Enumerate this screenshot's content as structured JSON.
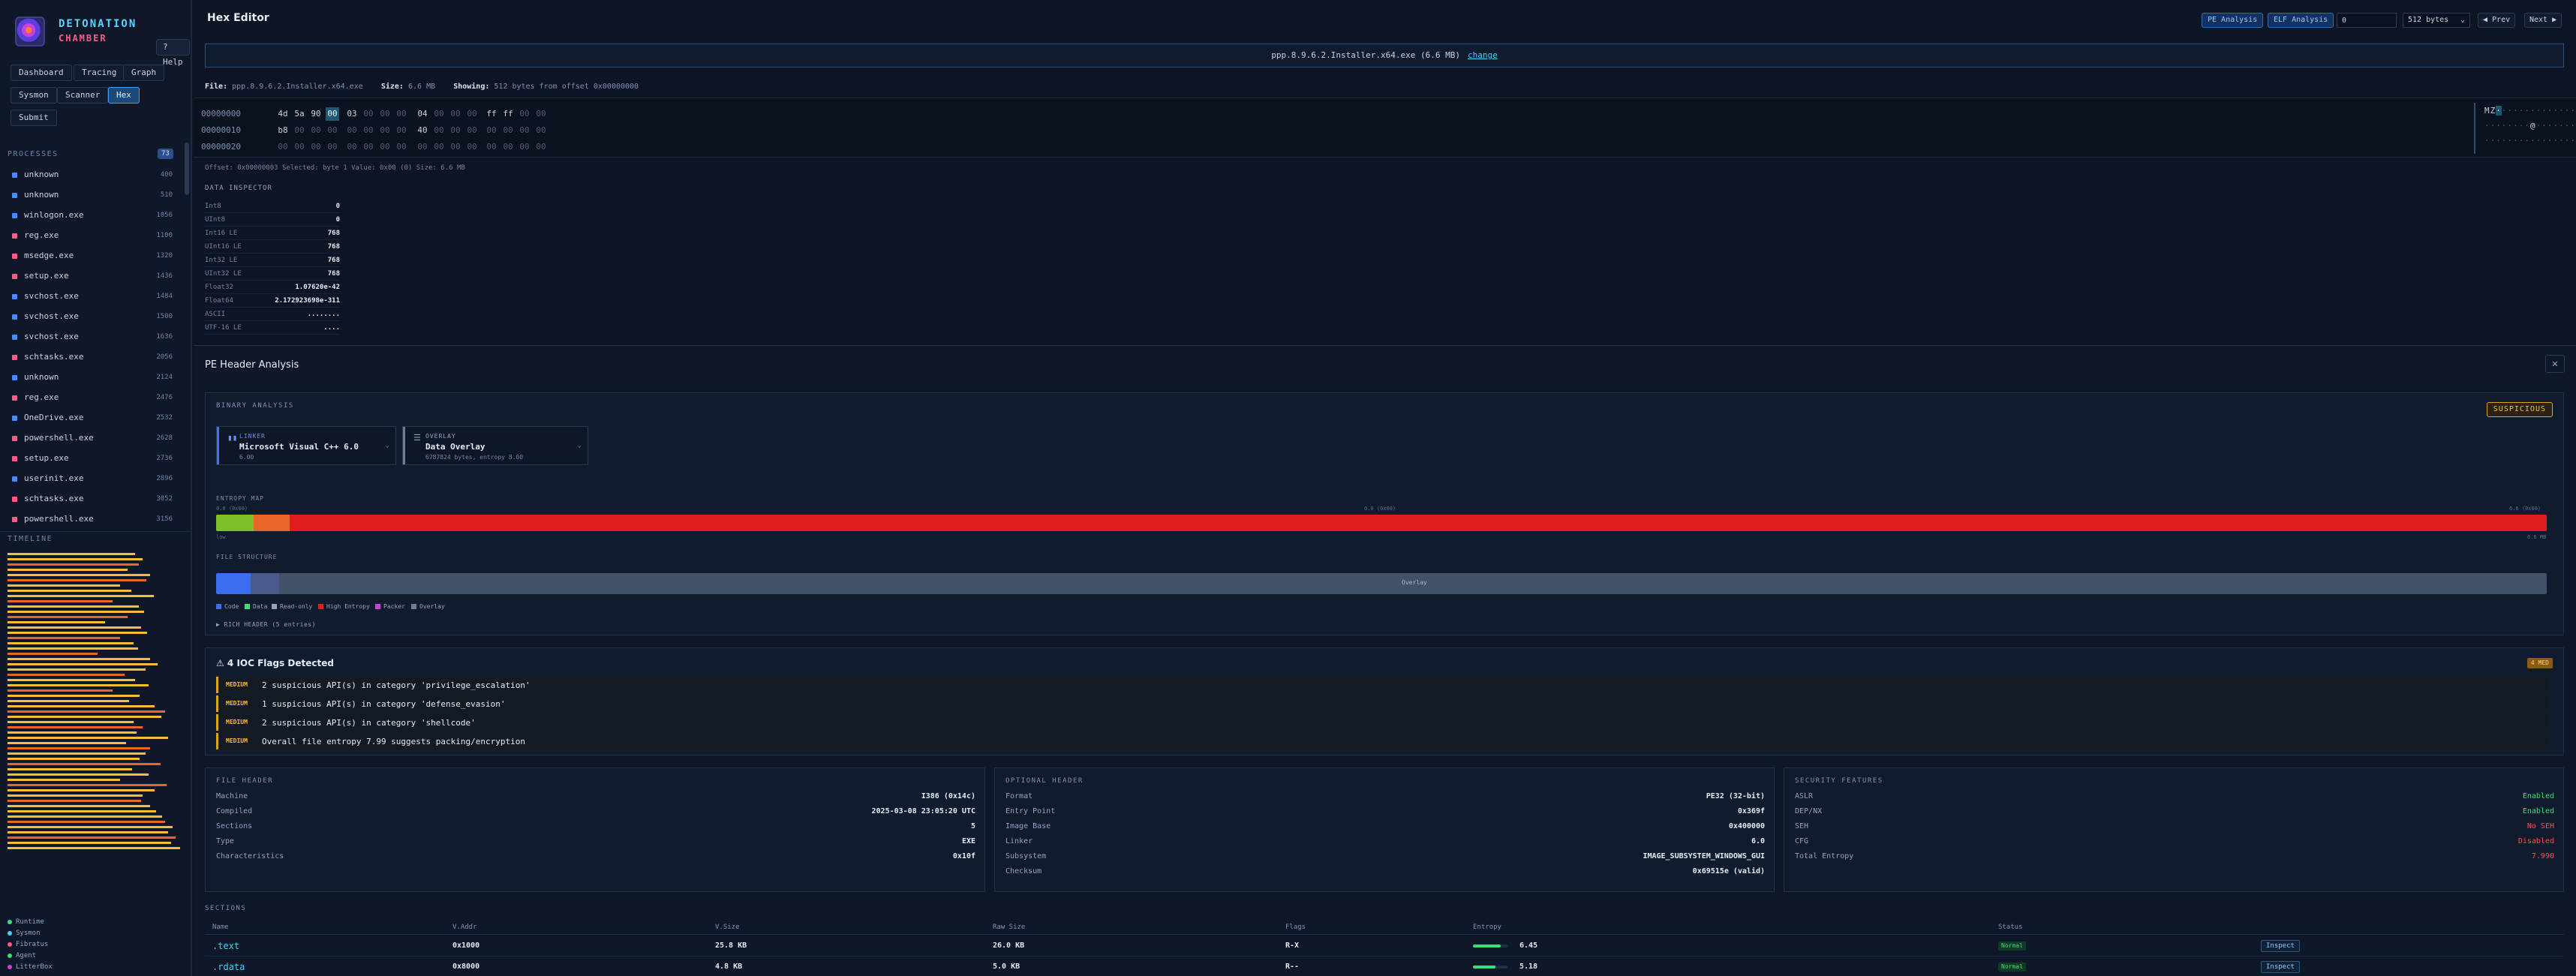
{
  "brand": {
    "title": "DETONATION",
    "subtitle": "CHAMBER",
    "help": "? Help"
  },
  "nav": [
    {
      "label": "Dashboard",
      "active": false
    },
    {
      "label": "Tracing",
      "active": false
    },
    {
      "label": "Graph",
      "active": false
    },
    {
      "label": "Sysmon",
      "active": false
    },
    {
      "label": "Scanner",
      "active": false
    },
    {
      "label": "Hex",
      "active": true
    },
    {
      "label": "Submit",
      "active": false
    }
  ],
  "processes": {
    "label": "PROCESSES",
    "count": "73",
    "items": [
      {
        "name": "unknown",
        "pid": "400",
        "color": "#4a8cff"
      },
      {
        "name": "unknown",
        "pid": "510",
        "color": "#4a8cff"
      },
      {
        "name": "winlogon.exe",
        "pid": "1056",
        "color": "#4a8cff"
      },
      {
        "name": "reg.exe",
        "pid": "1100",
        "color": "#ff5c86"
      },
      {
        "name": "msedge.exe",
        "pid": "1320",
        "color": "#ff5c86"
      },
      {
        "name": "setup.exe",
        "pid": "1436",
        "color": "#ff5c86"
      },
      {
        "name": "svchost.exe",
        "pid": "1484",
        "color": "#4a8cff"
      },
      {
        "name": "svchost.exe",
        "pid": "1500",
        "color": "#4a8cff"
      },
      {
        "name": "svchost.exe",
        "pid": "1636",
        "color": "#4a8cff"
      },
      {
        "name": "schtasks.exe",
        "pid": "2056",
        "color": "#ff5c86"
      },
      {
        "name": "unknown",
        "pid": "2124",
        "color": "#4a8cff"
      },
      {
        "name": "reg.exe",
        "pid": "2476",
        "color": "#ff5c86"
      },
      {
        "name": "OneDrive.exe",
        "pid": "2532",
        "color": "#4a8cff"
      },
      {
        "name": "powershell.exe",
        "pid": "2628",
        "color": "#ff5c86"
      },
      {
        "name": "setup.exe",
        "pid": "2736",
        "color": "#ff5c86"
      },
      {
        "name": "userinit.exe",
        "pid": "2896",
        "color": "#4a8cff"
      },
      {
        "name": "schtasks.exe",
        "pid": "3052",
        "color": "#ff5c86"
      },
      {
        "name": "powershell.exe",
        "pid": "3156",
        "color": "#ff5c86"
      }
    ]
  },
  "timeline": {
    "label": "TIMELINE"
  },
  "legend": [
    {
      "label": "Runtime",
      "color": "#3fdc7a"
    },
    {
      "label": "Sysmon",
      "color": "#3fd3ff"
    },
    {
      "label": "Fibratus",
      "color": "#ff5c86"
    },
    {
      "label": "Agent",
      "color": "#3fdc7a"
    },
    {
      "label": "LitterBox",
      "color": "#c642d9"
    }
  ],
  "hex_editor": {
    "title": "Hex Editor",
    "pe_button": "PE Analysis",
    "elf_button": "ELF Analysis",
    "offset_value": "0",
    "bytes_select": "512 bytes",
    "prev": "◀ Prev",
    "next": "Next ▶",
    "banner_file": "ppp.8.9.6.2.Installer.x64.exe (6.6 MB)",
    "banner_change": "change",
    "file_label": "File:",
    "file_value": "ppp.8.9.6.2.Installer.x64.exe",
    "size_label": "Size:",
    "size_value": "6.6 MB",
    "showing_label": "Showing:",
    "showing_value": "512 bytes from offset 0x00000000",
    "rows": [
      {
        "addr": "00000000",
        "bytes": [
          "4d",
          "5a",
          "90",
          "00",
          "03",
          "00",
          "00",
          "00",
          "04",
          "00",
          "00",
          "00",
          "ff",
          "ff",
          "00",
          "00"
        ]
      },
      {
        "addr": "00000010",
        "bytes": [
          "b8",
          "00",
          "00",
          "00",
          "00",
          "00",
          "00",
          "00",
          "40",
          "00",
          "00",
          "00",
          "00",
          "00",
          "00",
          "00"
        ]
      },
      {
        "addr": "00000020",
        "bytes": [
          "00",
          "00",
          "00",
          "00",
          "00",
          "00",
          "00",
          "00",
          "00",
          "00",
          "00",
          "00",
          "00",
          "00",
          "00",
          "00"
        ]
      }
    ],
    "ascii": [
      "MZ··············",
      "········@·······",
      "················"
    ],
    "status": "Offset: 0x00000003   Selected: byte 1   Value: 0x00 (0)   Size: 6.6 MB",
    "inspector_title": "DATA INSPECTOR",
    "inspector": [
      {
        "k": "Int8",
        "v": "0"
      },
      {
        "k": "UInt8",
        "v": "0"
      },
      {
        "k": "Int16 LE",
        "v": "768"
      },
      {
        "k": "UInt16 LE",
        "v": "768"
      },
      {
        "k": "Int32 LE",
        "v": "768"
      },
      {
        "k": "UInt32 LE",
        "v": "768"
      },
      {
        "k": "Float32",
        "v": "1.07620e-42"
      },
      {
        "k": "Float64",
        "v": "2.172923698e-311"
      },
      {
        "k": "ASCII",
        "v": "........"
      },
      {
        "k": "UTF-16 LE",
        "v": "...."
      }
    ]
  },
  "pe_panel": {
    "title": "PE Header Analysis",
    "close": "✕",
    "binary_analysis": "BINARY ANALYSIS",
    "verdict": "SUSPICIOUS",
    "linker": {
      "kind": "LINKER",
      "name": "Microsoft Visual C++ 6.0",
      "sub": "6.00"
    },
    "overlay": {
      "kind": "OVERLAY",
      "name": "Data Overlay",
      "sub": "6787824 bytes, entropy 8.00"
    },
    "entropy_map_label": "ENTROPY MAP",
    "entropy_left": "0.0 (0x00)",
    "entropy_mid": "0.0 (0x00)",
    "entropy_right": "6.6 (0x00)",
    "entropy_lo": "low",
    "entropy_hi": "6.6 MB",
    "file_structure_label": "FILE STRUCTURE",
    "overlay_label": "Overlay",
    "structure_legend": [
      {
        "label": "Code",
        "color": "#3a6df0"
      },
      {
        "label": "Data",
        "color": "#3fdc7a"
      },
      {
        "label": "Read-only",
        "color": "#8fa3c4"
      },
      {
        "label": "High Entropy",
        "color": "#e21d1d"
      },
      {
        "label": "Packer",
        "color": "#c642d9"
      },
      {
        "label": "Overlay",
        "color": "#6f7d94"
      }
    ],
    "rich_header": "▶ RICH HEADER (5 entries)",
    "ioc_title": "⚠  4 IOC Flags Detected",
    "ioc_badge": "4 MED",
    "iocs": [
      {
        "sev": "MEDIUM",
        "msg": "2 suspicious API(s) in category 'privilege_escalation'"
      },
      {
        "sev": "MEDIUM",
        "msg": "1 suspicious API(s) in category 'defense_evasion'"
      },
      {
        "sev": "MEDIUM",
        "msg": "2 suspicious API(s) in category 'shellcode'"
      },
      {
        "sev": "MEDIUM",
        "msg": "Overall file entropy 7.99 suggests packing/encryption"
      }
    ],
    "file_header": {
      "title": "FILE HEADER",
      "rows": [
        {
          "k": "Machine",
          "v": "I386 (0x14c)"
        },
        {
          "k": "Compiled",
          "v": "2025-03-08 23:05:20 UTC"
        },
        {
          "k": "Sections",
          "v": "5"
        },
        {
          "k": "Type",
          "v": "EXE"
        },
        {
          "k": "Characteristics",
          "v": "0x10f"
        }
      ]
    },
    "optional_header": {
      "title": "OPTIONAL HEADER",
      "rows": [
        {
          "k": "Format",
          "v": "PE32 (32-bit)"
        },
        {
          "k": "Entry Point",
          "v": "0x369f"
        },
        {
          "k": "Image Base",
          "v": "0x400000"
        },
        {
          "k": "Linker",
          "v": "6.0"
        },
        {
          "k": "Subsystem",
          "v": "IMAGE_SUBSYSTEM_WINDOWS_GUI"
        },
        {
          "k": "Checksum",
          "v": "0x69515e (valid)"
        }
      ]
    },
    "security": {
      "title": "SECURITY FEATURES",
      "rows": [
        {
          "k": "ASLR",
          "v": "Enabled",
          "tone": "green"
        },
        {
          "k": "DEP/NX",
          "v": "Enabled",
          "tone": "green"
        },
        {
          "k": "SEH",
          "v": "No SEH",
          "tone": "red"
        },
        {
          "k": "CFG",
          "v": "Disabled",
          "tone": "red"
        },
        {
          "k": "Total Entropy",
          "v": "7.990",
          "tone": "red"
        }
      ]
    },
    "sections_title": "SECTIONS",
    "sections_headers": [
      "Name",
      "V.Addr",
      "V.Size",
      "Raw Size",
      "Flags",
      "Entropy",
      "Status",
      ""
    ],
    "sections": [
      {
        "name": ".text",
        "vaddr": "0x1000",
        "vsize": "25.8 KB",
        "raw": "26.0 KB",
        "flags": "R-X",
        "entropy": "6.45",
        "entropy_frac": 0.81,
        "status": "Normal",
        "action": "Inspect"
      },
      {
        "name": ".rdata",
        "vaddr": "0x8000",
        "vsize": "4.8 KB",
        "raw": "5.0 KB",
        "flags": "R--",
        "entropy": "5.18",
        "entropy_frac": 0.65,
        "status": "Normal",
        "action": "Inspect"
      }
    ]
  },
  "colors": {
    "accent": "#3fd3ff",
    "danger": "#e21d1d",
    "warn": "#e0a21a",
    "ok": "#3fdc7a"
  }
}
